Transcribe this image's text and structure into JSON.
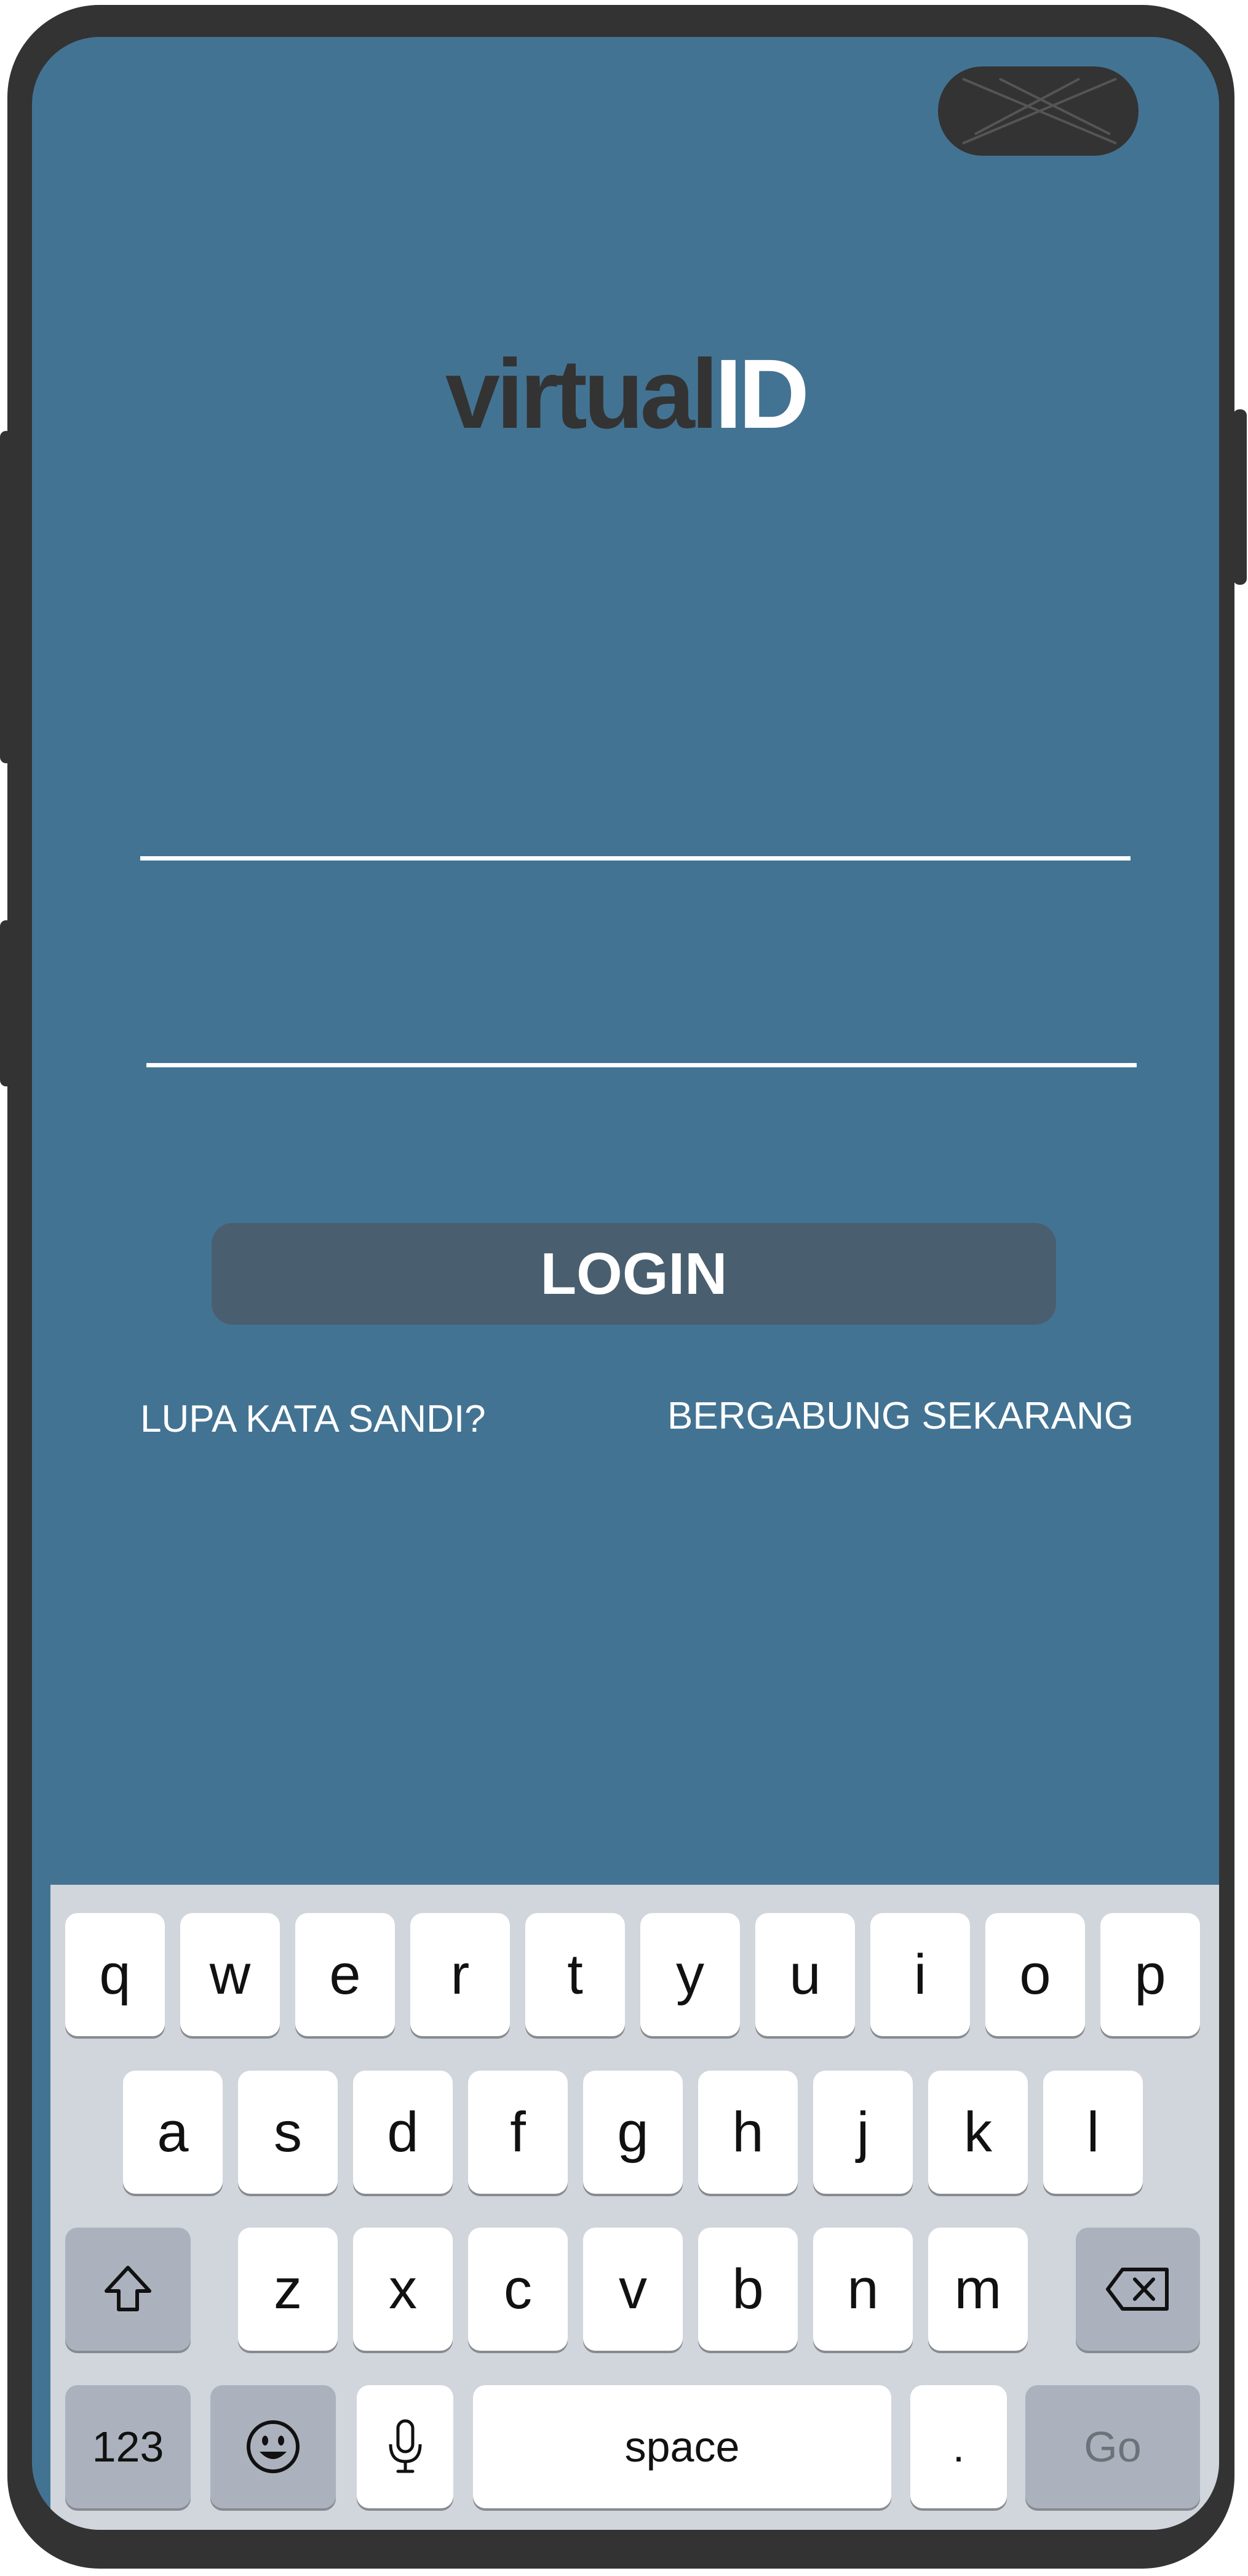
{
  "app": {
    "logo_part1": "virtual",
    "logo_part2": "ID"
  },
  "form": {
    "username_placeholder": "",
    "password_placeholder": "",
    "login_label": "LOGIN",
    "forgot_password_label": "LUPA KATA SANDI?",
    "join_label": "BERGABUNG SEKARANG"
  },
  "keyboard": {
    "row1": [
      "q",
      "w",
      "e",
      "r",
      "t",
      "y",
      "u",
      "i",
      "o",
      "p"
    ],
    "row2": [
      "a",
      "s",
      "d",
      "f",
      "g",
      "h",
      "j",
      "k",
      "l"
    ],
    "row3": [
      "z",
      "x",
      "c",
      "v",
      "b",
      "n",
      "m"
    ],
    "numbers_label": "123",
    "space_label": "space",
    "period_label": ".",
    "go_label": "Go",
    "shift_icon": "shift-arrow-icon",
    "delete_icon": "backspace-icon",
    "emoji_icon": "emoji-icon",
    "mic_icon": "microphone-icon"
  },
  "colors": {
    "screen_background": "#437393",
    "login_button": "#495f6f",
    "keyboard_background": "#d1d5dc",
    "phone_frame": "#333333"
  }
}
